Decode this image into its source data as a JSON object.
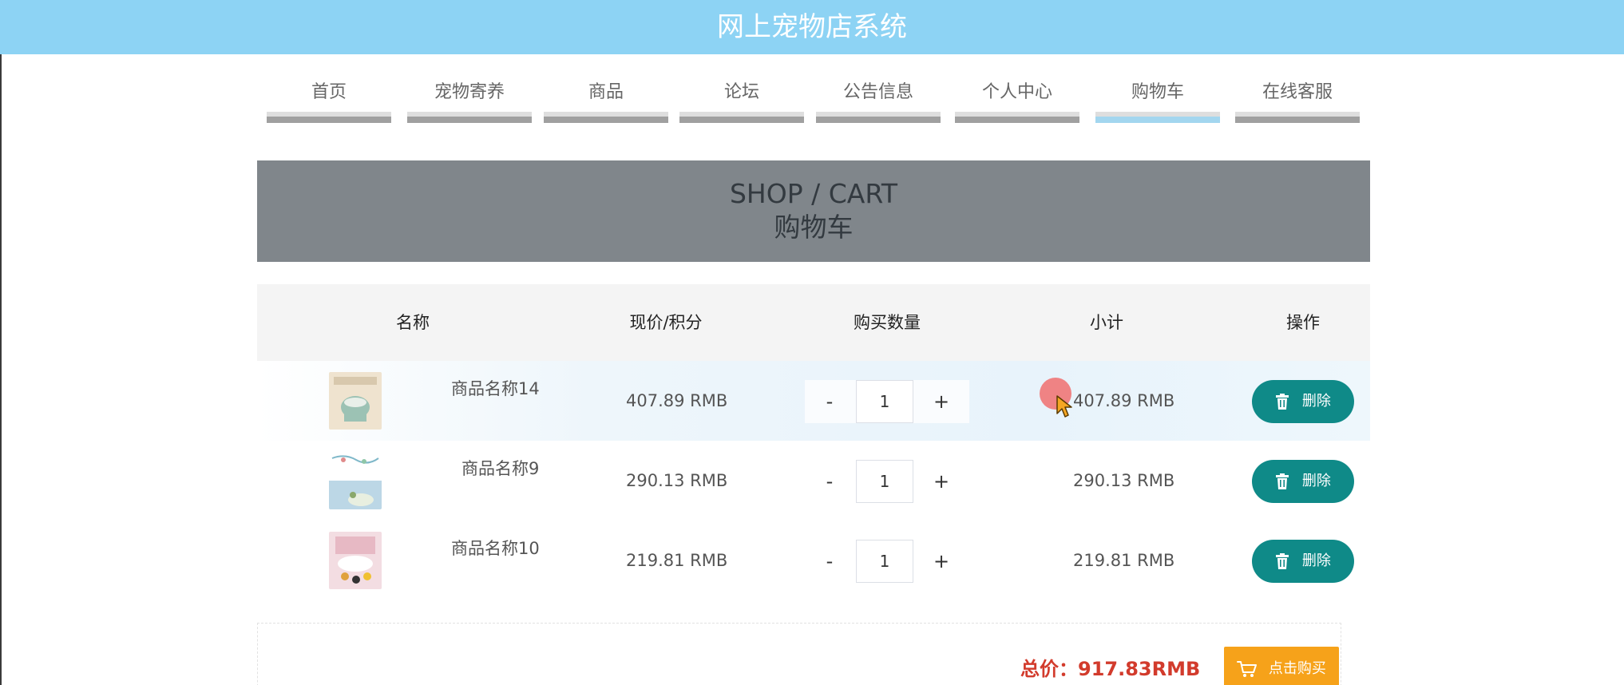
{
  "header": {
    "title": "网上宠物店系统"
  },
  "nav": [
    {
      "label": "首页",
      "active": false
    },
    {
      "label": "宠物寄养",
      "active": false
    },
    {
      "label": "商品",
      "active": false
    },
    {
      "label": "论坛",
      "active": false
    },
    {
      "label": "公告信息",
      "active": false
    },
    {
      "label": "个人中心",
      "active": false
    },
    {
      "label": "购物车",
      "active": true
    },
    {
      "label": "在线客服",
      "active": false
    }
  ],
  "banner": {
    "en": "SHOP / CART",
    "cn": "购物车"
  },
  "table": {
    "headers": [
      "名称",
      "现价/积分",
      "购买数量",
      "小计",
      "操作"
    ],
    "rows": [
      {
        "name": "商品名称14",
        "price": "407.89 RMB",
        "qty": "1",
        "subtotal": "407.89 RMB",
        "delete_label": "删除",
        "minus": "-",
        "plus": "+"
      },
      {
        "name": "商品名称9",
        "price": "290.13 RMB",
        "qty": "1",
        "subtotal": "290.13 RMB",
        "delete_label": "删除",
        "minus": "-",
        "plus": "+"
      },
      {
        "name": "商品名称10",
        "price": "219.81 RMB",
        "qty": "1",
        "subtotal": "219.81 RMB",
        "delete_label": "删除",
        "minus": "-",
        "plus": "+"
      }
    ]
  },
  "footer": {
    "total": "总价：917.83RMB",
    "buy_label": "点击购买"
  },
  "icons": {
    "delete": "trash-icon",
    "buy": "cart-icon"
  },
  "colors": {
    "header": "#8dd3f4",
    "delete_button": "#0f8a88",
    "buy_button": "#f6a21a",
    "total_text": "#d23b2c"
  }
}
